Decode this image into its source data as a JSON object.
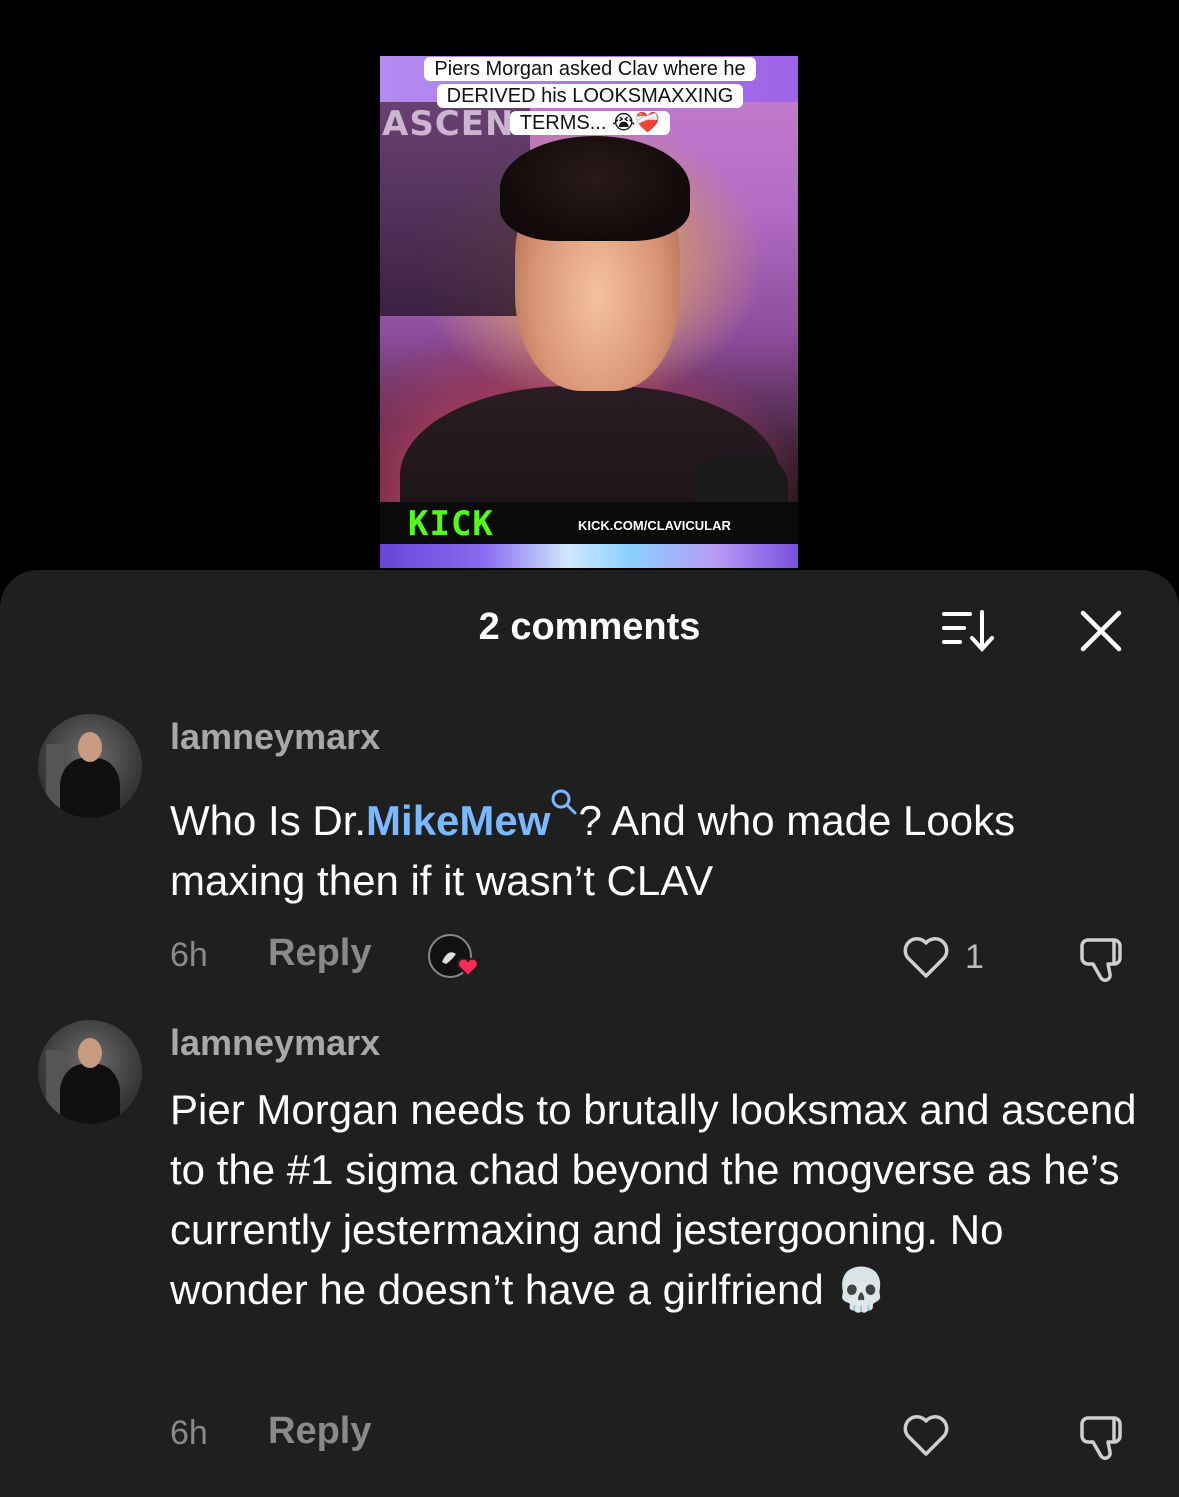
{
  "video": {
    "caption": "Piers Morgan asked Clav where he DERIVED his LOOKSMAXXING TERMS... 😭❤️‍🩹",
    "background_text": "ASCEN",
    "brand": "KICK",
    "brand_url": "KICK.COM/CLAVICULAR",
    "brand_color": "#53fc18"
  },
  "comments_panel": {
    "title": "2 comments",
    "sort_icon": "sort-icon",
    "close_icon": "close-icon"
  },
  "comments": [
    {
      "username": "lamneymarx",
      "text_before": "Who Is Dr.",
      "mention": "MikeMew",
      "text_after": "? And who made Looks maxing then if it wasn’t CLAV",
      "time": "6h",
      "reply_label": "Reply",
      "likes": "1",
      "creator_liked": true
    },
    {
      "username": "lamneymarx",
      "text": "Pier Morgan needs to brutally looksmax and ascend to the #1 sigma chad beyond the mogverse as he’s currently jestermaxing and jestergooning. No wonder he doesn’t have a girlfriend 💀",
      "time": "6h",
      "reply_label": "Reply",
      "likes": ""
    }
  ],
  "colors": {
    "sheet_bg": "#1f1f1f",
    "mention": "#7ab8ff",
    "muted": "#8a8a8a"
  }
}
